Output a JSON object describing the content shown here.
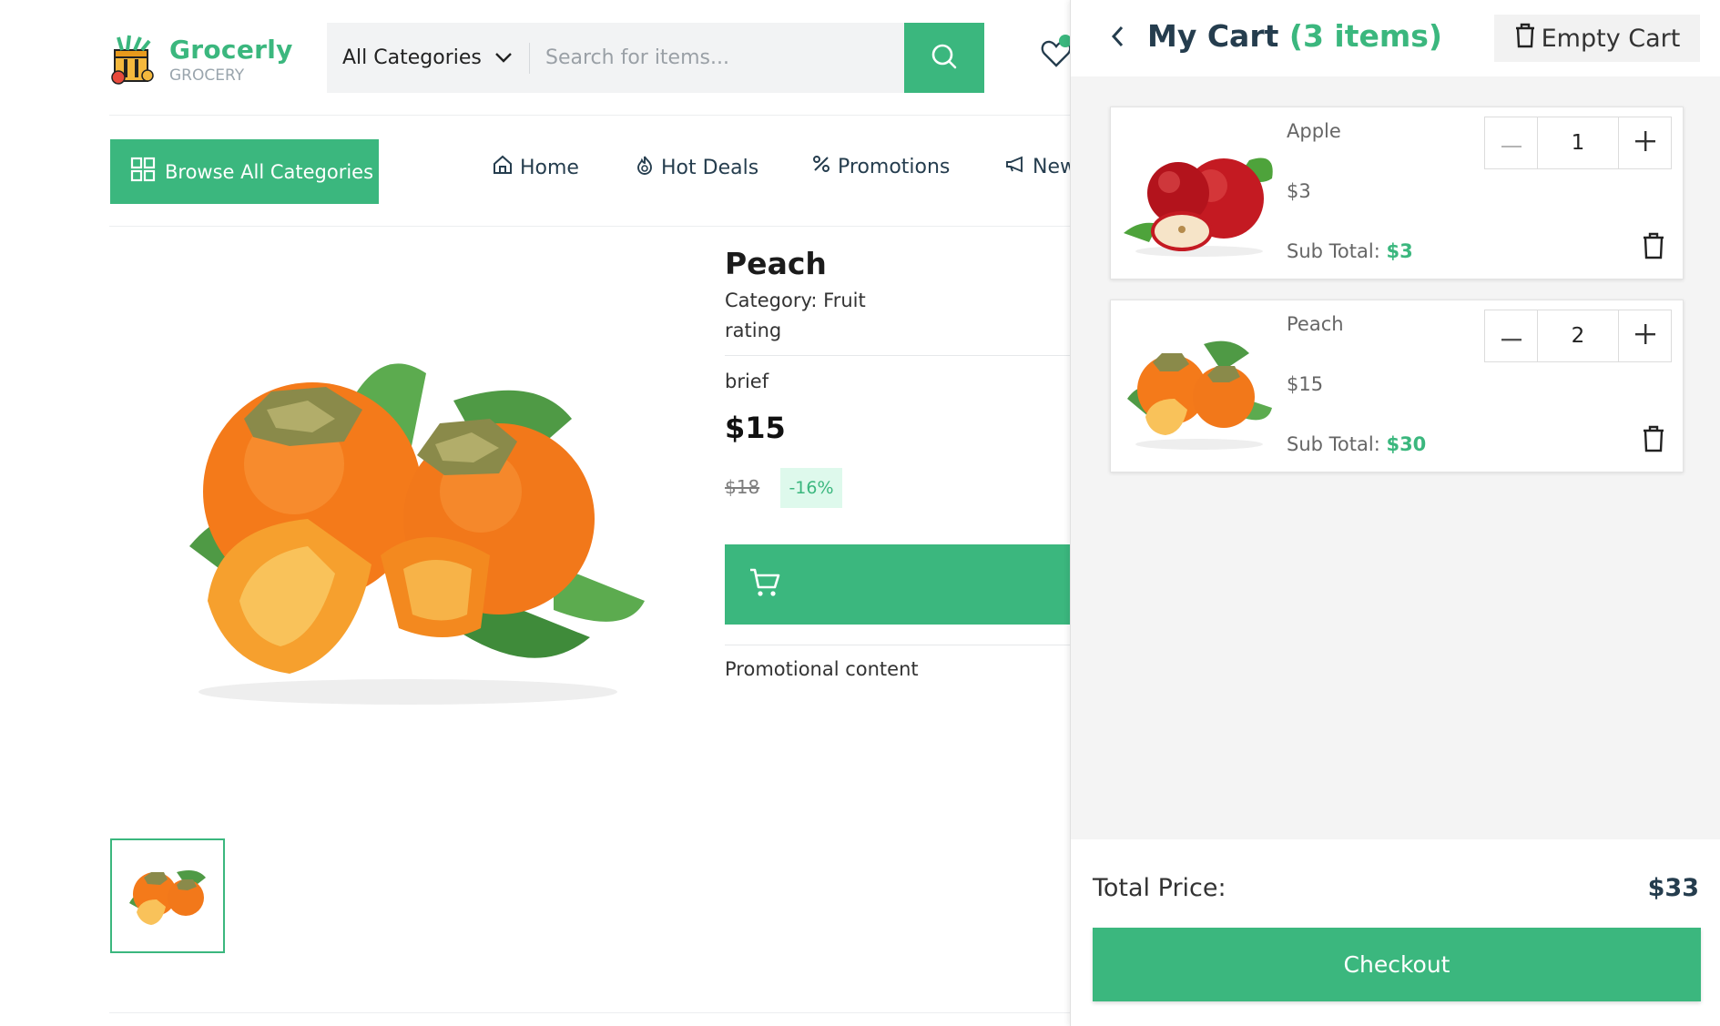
{
  "brand": {
    "name": "Grocerly",
    "tagline": "GROCERY",
    "accent": "#3bb77e"
  },
  "search": {
    "category_label": "All Categories",
    "placeholder": "Search for items...",
    "value": ""
  },
  "nav": {
    "browse_label": "Browse All Categories",
    "items": [
      {
        "label": "Home",
        "icon": "home-icon"
      },
      {
        "label": "Hot Deals",
        "icon": "flame-icon"
      },
      {
        "label": "Promotions",
        "icon": "percent-icon"
      },
      {
        "label": "New",
        "icon": "megaphone-icon"
      }
    ]
  },
  "product": {
    "title": "Peach",
    "category": "Category: Fruit",
    "rating": "rating",
    "brief": "brief",
    "price": "$15",
    "old_price": "$18",
    "discount": "-16%",
    "promo": "Promotional content"
  },
  "cart": {
    "title": "My Cart",
    "count_label": "(3 items)",
    "empty_label": "Empty Cart",
    "items": [
      {
        "name": "Apple",
        "price": "$3",
        "qty": "1",
        "subtotal_label": "Sub Total:",
        "subtotal": "$3"
      },
      {
        "name": "Peach",
        "price": "$15",
        "qty": "2",
        "subtotal_label": "Sub Total:",
        "subtotal": "$30"
      }
    ],
    "total_label": "Total Price:",
    "total": "$33",
    "checkout_label": "Checkout"
  }
}
